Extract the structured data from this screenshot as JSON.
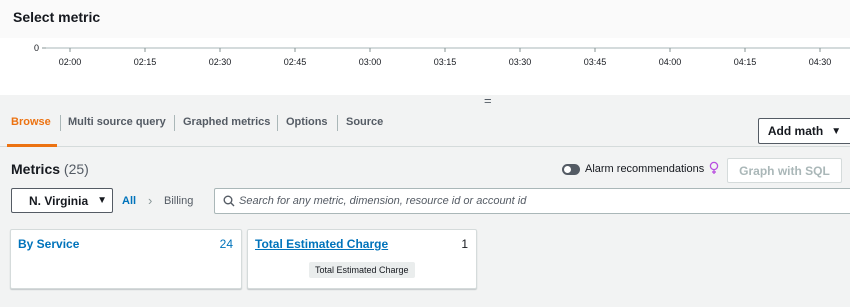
{
  "header": {
    "title": "Select metric"
  },
  "chart": {
    "y_tick": "0",
    "x_ticks": [
      "02:00",
      "02:15",
      "02:30",
      "02:45",
      "03:00",
      "03:15",
      "03:30",
      "03:45",
      "04:00",
      "04:15",
      "04:30"
    ]
  },
  "splitter": {
    "handle": "="
  },
  "tabs": [
    {
      "label": "Browse",
      "active": true
    },
    {
      "label": "Multi source query"
    },
    {
      "label": "Graphed metrics"
    },
    {
      "label": "Options"
    },
    {
      "label": "Source"
    }
  ],
  "toolbar": {
    "add_math_label": "Add math"
  },
  "metrics": {
    "title": "Metrics",
    "count": "(25)",
    "alarm_recommendations_label": "Alarm recommendations",
    "graph_with_sql_label": "Graph with SQL"
  },
  "filter": {
    "region": "N. Virginia",
    "breadcrumb_all": "All",
    "breadcrumb_billing": "Billing",
    "search_placeholder": "Search for any metric, dimension, resource id or account id"
  },
  "cards": [
    {
      "title": "By Service",
      "count": "24"
    },
    {
      "title": "Total Estimated Charge",
      "count": "1",
      "tooltip": "Total Estimated Charge"
    }
  ],
  "colors": {
    "accent": "#ec7211",
    "link": "#0073bb",
    "background": "#f2f3f3"
  },
  "icons": [
    "chevron-down-icon",
    "chevron-right-icon",
    "search-icon",
    "lightbulb-icon",
    "toggle-switch"
  ]
}
